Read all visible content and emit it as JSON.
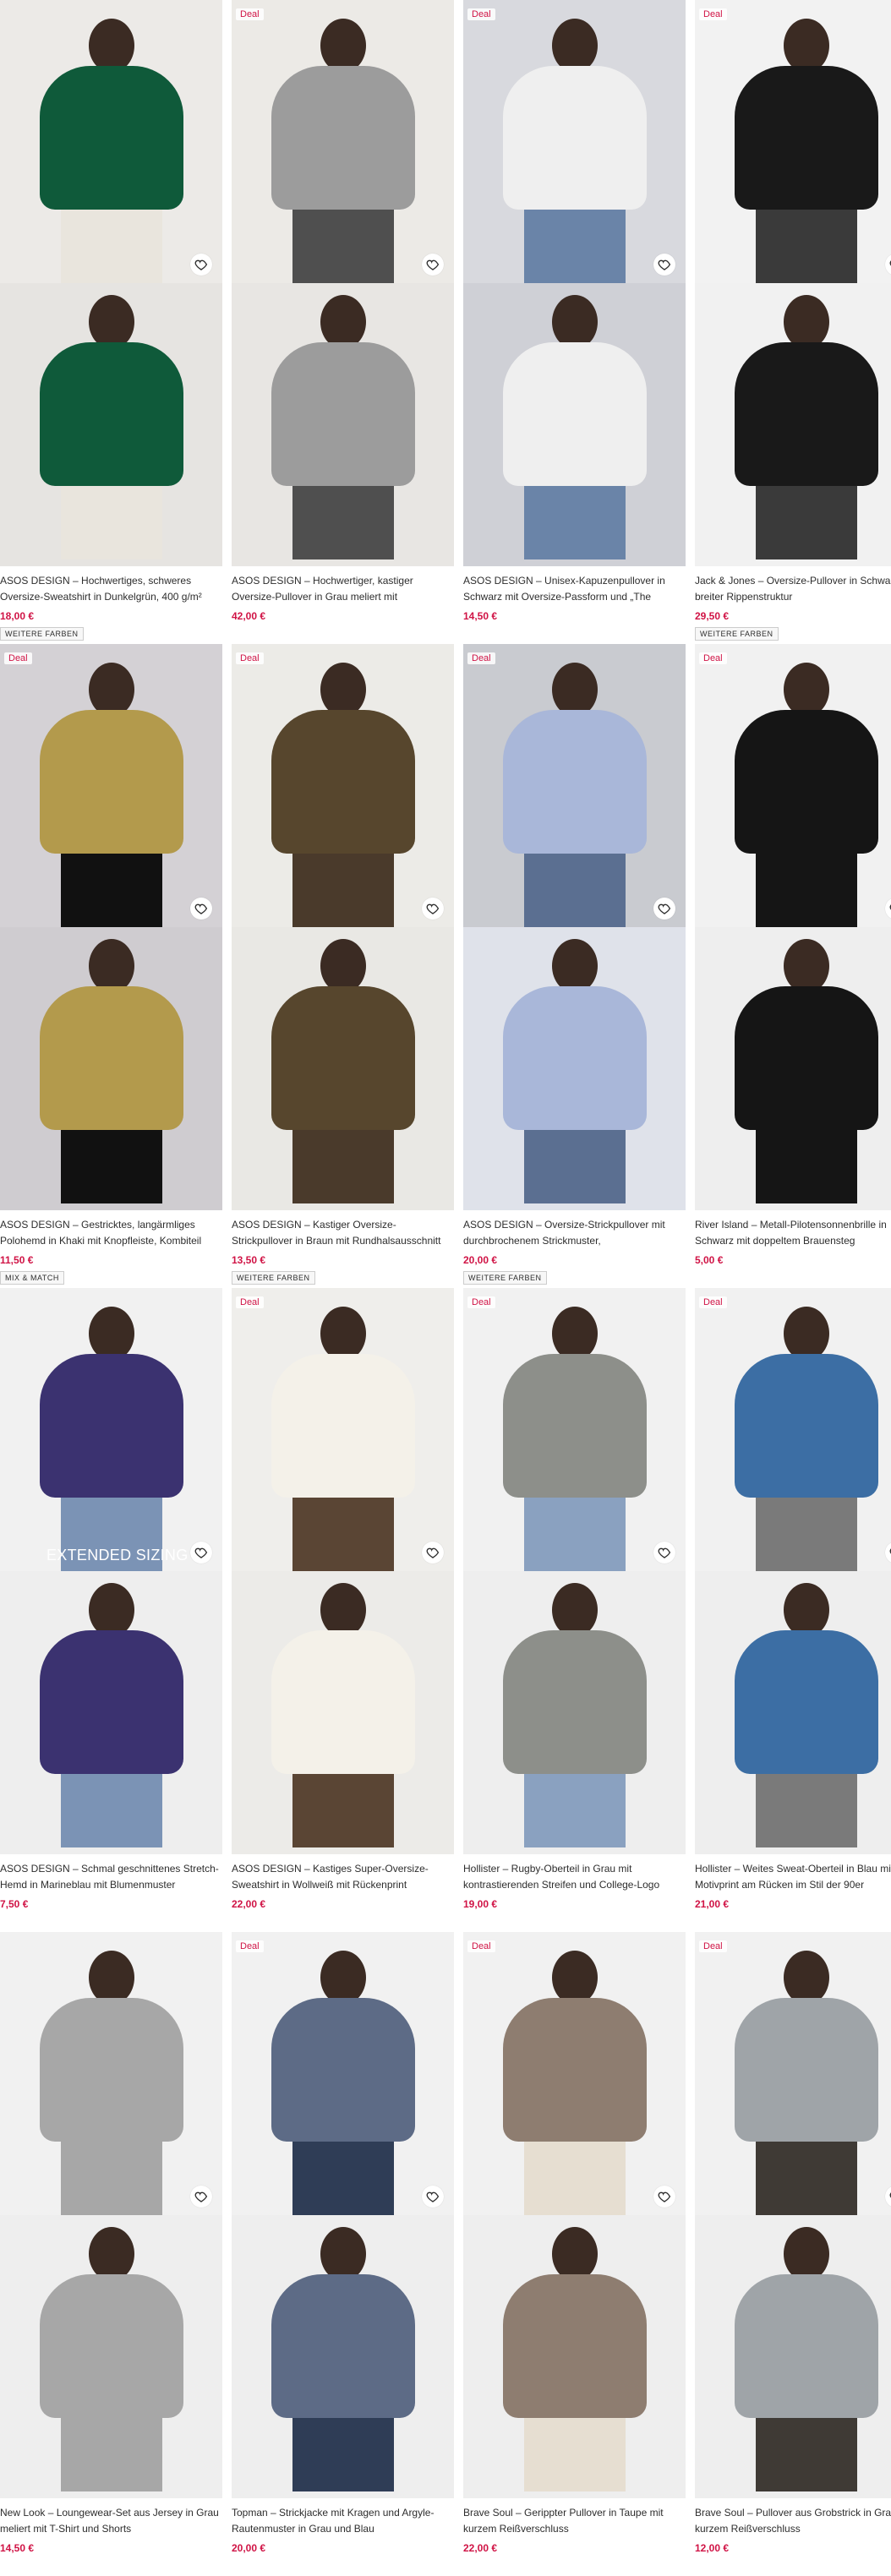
{
  "badges": {
    "deal": "Deal",
    "more_colours": "WEITERE FARBEN",
    "mix_match": "MIX & MATCH",
    "extended_sizing": "EXTENDED SIZING"
  },
  "products": [
    {
      "title": "ASOS DESIGN – Hochwertiges, schweres Oversize-Sweatshirt in Dunkelgrün, 400 g/m²",
      "price": "18,00 €",
      "deal": false,
      "chip": "WEITERE FARBEN",
      "bg1": "#eceae7",
      "bg2": "#e6e4e1",
      "garment": "#0f5a3a",
      "legs": "#e9e5dd"
    },
    {
      "title": "ASOS DESIGN – Hochwertiger, kastiger Oversize-Pullover in Grau meliert mit Rundhalsausschnitt aus…",
      "price": "42,00 €",
      "deal": true,
      "chip": "",
      "bg1": "#eceae6",
      "bg2": "#e8e6e3",
      "garment": "#9c9c9c",
      "legs": "#4f4f4f"
    },
    {
      "title": "ASOS DESIGN – Unisex-Kapuzenpullover in Schwarz mit Oversize-Passform und „The Beatles“-…",
      "price": "14,50 €",
      "deal": true,
      "chip": "",
      "bg1": "#d8d9de",
      "bg2": "#cfd0d6",
      "garment": "#efefef",
      "legs": "#6a84a8"
    },
    {
      "title": "Jack & Jones – Oversize-Pullover in Schwarz mit breiter Rippenstruktur",
      "price": "29,50 €",
      "deal": true,
      "chip": "WEITERE FARBEN",
      "bg1": "#f2f2f2",
      "bg2": "#f1f1f1",
      "garment": "#191919",
      "legs": "#3a3a3a"
    },
    {
      "title": "ASOS DESIGN – Gestricktes, langärmliges Polohemd in Khaki mit Knopfleiste, Kombiteil",
      "price": "11,50 €",
      "deal": true,
      "chip": "MIX & MATCH",
      "bg1": "#d4d1d5",
      "bg2": "#cfccd0",
      "garment": "#b39a4c",
      "legs": "#111111"
    },
    {
      "title": "ASOS DESIGN – Kastiger Oversize-Strickpullover in Braun mit Rundhalsausschnitt und gerippten Ärmeln",
      "price": "13,50 €",
      "deal": true,
      "chip": "WEITERE FARBEN",
      "bg1": "#ecebe7",
      "bg2": "#e9e8e4",
      "garment": "#57462d",
      "legs": "#4a3a2b"
    },
    {
      "title": "ASOS DESIGN – Oversize-Strickpullover mit durchbrochenem Strickmuster, Rundhalsausschnitt…",
      "price": "20,00 €",
      "deal": true,
      "chip": "WEITERE FARBEN",
      "bg1": "#c9cbd0",
      "bg2": "#dfe2ea",
      "garment": "#a9b7d9",
      "legs": "#5b6f91"
    },
    {
      "title": "River Island – Metall-Pilotensonnenbrille in Schwarz mit doppeltem Brauensteg",
      "price": "5,00 €",
      "deal": true,
      "chip": "",
      "bg1": "#f1f1f1",
      "bg2": "#eeeeee",
      "garment": "#151515",
      "legs": "#151515"
    },
    {
      "title": "ASOS DESIGN – Schmal geschnittenes Stretch-Hemd in Marineblau mit Blumenmuster",
      "price": "7,50 €",
      "deal": false,
      "chip": "",
      "bg1": "#f1f1f1",
      "bg2": "#eeeeee",
      "garment": "#3b3270",
      "legs": "#7b93b5",
      "overlay": true
    },
    {
      "title": "ASOS DESIGN – Kastiges Super-Oversize-Sweatshirt in Wollweiß mit Rückenprint",
      "price": "22,00 €",
      "deal": true,
      "chip": "",
      "bg1": "#efeeeb",
      "bg2": "#ecebe8",
      "garment": "#f4f1e9",
      "legs": "#5a4534"
    },
    {
      "title": "Hollister – Rugby-Oberteil in Grau mit kontrastierenden Streifen und College-Logo",
      "price": "19,00 €",
      "deal": true,
      "chip": "",
      "bg1": "#f1f1f1",
      "bg2": "#eeeeee",
      "garment": "#8d8f8a",
      "legs": "#8aa1c0"
    },
    {
      "title": "Hollister – Weites Sweat-Oberteil in Blau mit Motivprint am Rücken im Stil der 90er",
      "price": "21,00 €",
      "deal": true,
      "chip": "",
      "bg1": "#f1f1f1",
      "bg2": "#eeeeee",
      "garment": "#3c6ea4",
      "legs": "#7a7a7a"
    },
    {
      "title": "New Look – Loungewear-Set aus Jersey in Grau meliert mit T-Shirt und Shorts",
      "price": "14,50 €",
      "deal": false,
      "chip": "",
      "bg1": "#f1f1f1",
      "bg2": "#eeeeee",
      "garment": "#a7a7a7",
      "legs": "#a7a7a7"
    },
    {
      "title": "Topman – Strickjacke mit Kragen und Argyle-Rautenmuster in Grau und Blau",
      "price": "20,00 €",
      "deal": true,
      "chip": "",
      "bg1": "#f1f1f1",
      "bg2": "#eeeeee",
      "garment": "#5d6b86",
      "legs": "#2f3d56"
    },
    {
      "title": "Brave Soul – Gerippter Pullover in Taupe mit kurzem Reißverschluss",
      "price": "22,00 €",
      "deal": true,
      "chip": "",
      "bg1": "#f1f1f1",
      "bg2": "#eeeeee",
      "garment": "#8e7d70",
      "legs": "#e6ded1"
    },
    {
      "title": "Brave Soul – Pullover aus Grobstrick in Grau mit kurzem Reißverschluss",
      "price": "12,00 €",
      "deal": true,
      "chip": "",
      "bg1": "#f1f1f1",
      "bg2": "#eeeeee",
      "garment": "#9fa4a8",
      "legs": "#3f3a35"
    }
  ]
}
